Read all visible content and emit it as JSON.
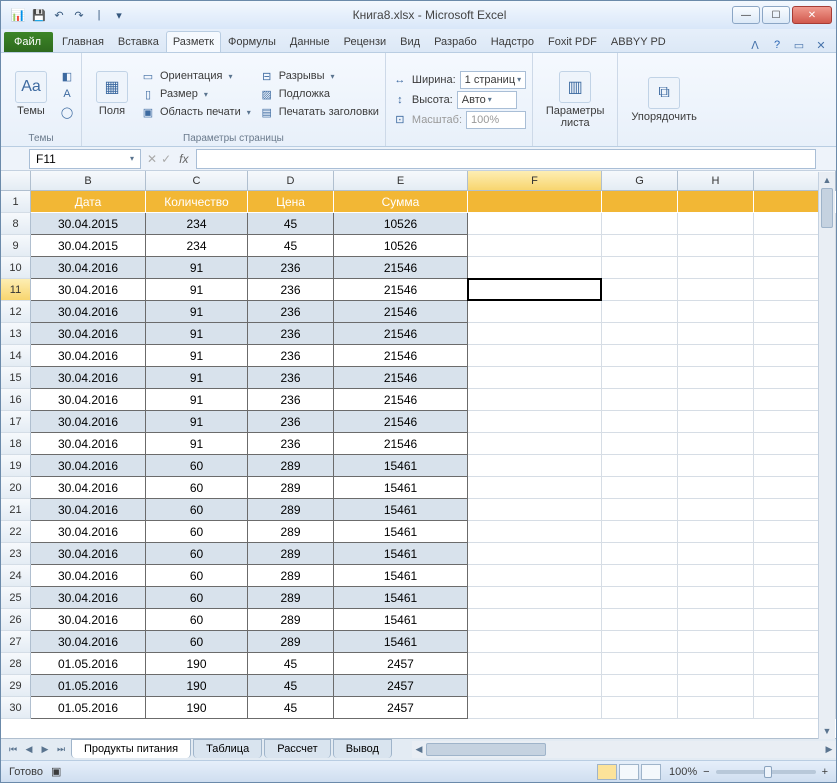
{
  "title": "Книга8.xlsx - Microsoft Excel",
  "qat": {
    "save": "💾",
    "undo": "↶",
    "redo": "↷"
  },
  "tabs": {
    "file": "Файл",
    "items": [
      "Главная",
      "Вставка",
      "Разметк",
      "Формулы",
      "Данные",
      "Рецензи",
      "Вид",
      "Разрабо",
      "Надстро",
      "Foxit PDF",
      "ABBYY PD"
    ]
  },
  "ribbon": {
    "themes": {
      "big": "Темы",
      "group": "Темы"
    },
    "margins": {
      "big": "Поля",
      "orientation": "Ориентация",
      "size": "Размер",
      "printarea": "Область печати",
      "group": "Параметры страницы",
      "breaks": "Разрывы",
      "background": "Подложка",
      "titles": "Печатать заголовки"
    },
    "scale": {
      "width": "Ширина:",
      "width_val": "1 страниц",
      "height": "Высота:",
      "height_val": "Авто",
      "scale": "Масштаб:",
      "scale_val": "100%",
      "group": ""
    },
    "sheet": {
      "big": "Параметры листа"
    },
    "arrange": {
      "big": "Упорядочить"
    }
  },
  "namebox": "F11",
  "fx": "fx",
  "columns": [
    "B",
    "C",
    "D",
    "E",
    "F",
    "G",
    "H"
  ],
  "header_row_num": "1",
  "headers": [
    "Дата",
    "Количество",
    "Цена",
    "Сумма"
  ],
  "rows": [
    {
      "n": "8",
      "v": [
        "30.04.2015",
        "234",
        "45",
        "10526"
      ],
      "band": true
    },
    {
      "n": "9",
      "v": [
        "30.04.2015",
        "234",
        "45",
        "10526"
      ],
      "band": false
    },
    {
      "n": "10",
      "v": [
        "30.04.2016",
        "91",
        "236",
        "21546"
      ],
      "band": true
    },
    {
      "n": "11",
      "v": [
        "30.04.2016",
        "91",
        "236",
        "21546"
      ],
      "band": false,
      "sel": true
    },
    {
      "n": "12",
      "v": [
        "30.04.2016",
        "91",
        "236",
        "21546"
      ],
      "band": true
    },
    {
      "n": "13",
      "v": [
        "30.04.2016",
        "91",
        "236",
        "21546"
      ],
      "band": true
    },
    {
      "n": "14",
      "v": [
        "30.04.2016",
        "91",
        "236",
        "21546"
      ],
      "band": false
    },
    {
      "n": "15",
      "v": [
        "30.04.2016",
        "91",
        "236",
        "21546"
      ],
      "band": true
    },
    {
      "n": "16",
      "v": [
        "30.04.2016",
        "91",
        "236",
        "21546"
      ],
      "band": false
    },
    {
      "n": "17",
      "v": [
        "30.04.2016",
        "91",
        "236",
        "21546"
      ],
      "band": true
    },
    {
      "n": "18",
      "v": [
        "30.04.2016",
        "91",
        "236",
        "21546"
      ],
      "band": false
    },
    {
      "n": "19",
      "v": [
        "30.04.2016",
        "60",
        "289",
        "15461"
      ],
      "band": true
    },
    {
      "n": "20",
      "v": [
        "30.04.2016",
        "60",
        "289",
        "15461"
      ],
      "band": false
    },
    {
      "n": "21",
      "v": [
        "30.04.2016",
        "60",
        "289",
        "15461"
      ],
      "band": true
    },
    {
      "n": "22",
      "v": [
        "30.04.2016",
        "60",
        "289",
        "15461"
      ],
      "band": false
    },
    {
      "n": "23",
      "v": [
        "30.04.2016",
        "60",
        "289",
        "15461"
      ],
      "band": true
    },
    {
      "n": "24",
      "v": [
        "30.04.2016",
        "60",
        "289",
        "15461"
      ],
      "band": false
    },
    {
      "n": "25",
      "v": [
        "30.04.2016",
        "60",
        "289",
        "15461"
      ],
      "band": true
    },
    {
      "n": "26",
      "v": [
        "30.04.2016",
        "60",
        "289",
        "15461"
      ],
      "band": false
    },
    {
      "n": "27",
      "v": [
        "30.04.2016",
        "60",
        "289",
        "15461"
      ],
      "band": true
    },
    {
      "n": "28",
      "v": [
        "01.05.2016",
        "190",
        "45",
        "2457"
      ],
      "band": false
    },
    {
      "n": "29",
      "v": [
        "01.05.2016",
        "190",
        "45",
        "2457"
      ],
      "band": true
    },
    {
      "n": "30",
      "v": [
        "01.05.2016",
        "190",
        "45",
        "2457"
      ],
      "band": false
    }
  ],
  "sheets": [
    "Продукты питания",
    "Таблица",
    "Рассчет",
    "Вывод"
  ],
  "status": {
    "ready": "Готово",
    "zoom": "100%",
    "minus": "−",
    "plus": "+"
  }
}
